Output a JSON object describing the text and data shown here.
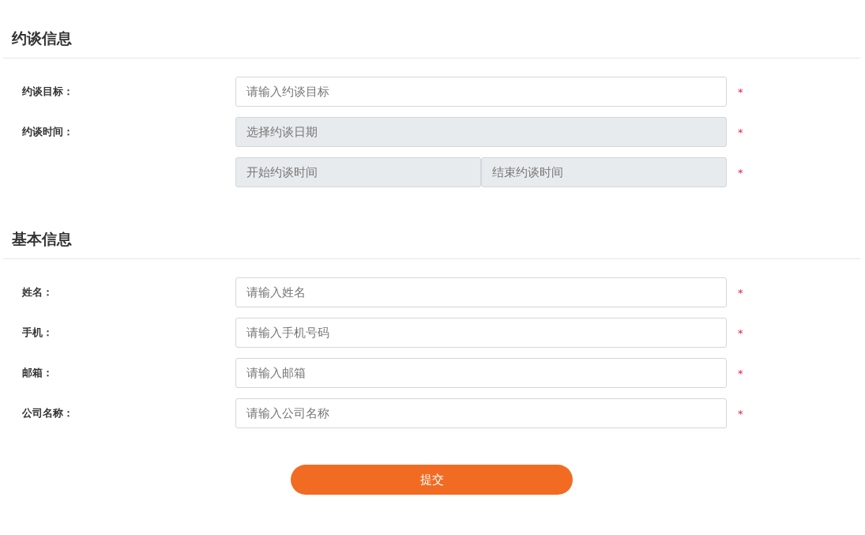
{
  "sections": [
    {
      "title": "约谈信息",
      "rows": [
        {
          "label": "约谈目标：",
          "required": "*",
          "fields": [
            {
              "placeholder": "请输入约谈目标",
              "disabled": false
            }
          ]
        },
        {
          "label": "约谈时间：",
          "required": "*",
          "fields": [
            {
              "placeholder": "选择约谈日期",
              "disabled": true
            }
          ]
        },
        {
          "required": "*",
          "fields": [
            {
              "placeholder": "开始约谈时间",
              "disabled": true
            },
            {
              "placeholder": "结束约谈时间",
              "disabled": true
            }
          ]
        }
      ]
    },
    {
      "title": "基本信息",
      "rows": [
        {
          "label": "姓名：",
          "required": "*",
          "fields": [
            {
              "placeholder": "请输入姓名",
              "disabled": false
            }
          ]
        },
        {
          "label": "手机：",
          "required": "*",
          "fields": [
            {
              "placeholder": "请输入手机号码",
              "disabled": false
            }
          ]
        },
        {
          "label": "邮箱：",
          "required": "*",
          "fields": [
            {
              "placeholder": "请输入邮箱",
              "disabled": false
            }
          ]
        },
        {
          "label": "公司名称：",
          "required": "*",
          "fields": [
            {
              "placeholder": "请输入公司名称",
              "disabled": false
            }
          ]
        }
      ]
    }
  ],
  "submit": {
    "label": "提交"
  }
}
